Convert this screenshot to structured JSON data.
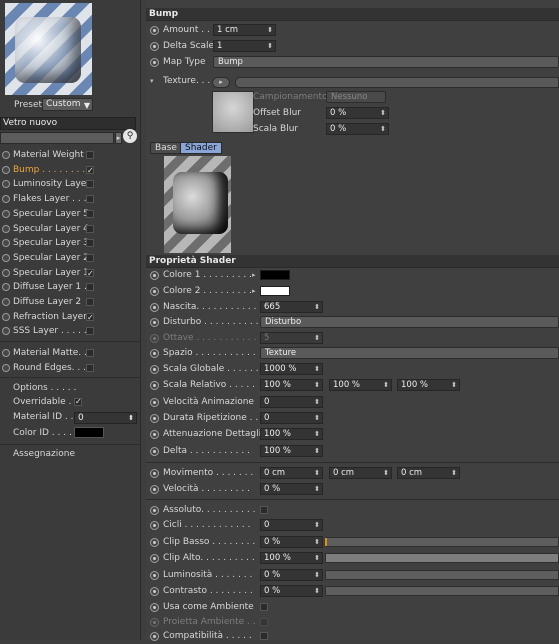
{
  "left": {
    "preset_label": "Preset",
    "preset_value": "Custom",
    "material_name": "Vetro nuovo",
    "layers": [
      {
        "label": "Material Weight",
        "checked": false,
        "active": false
      },
      {
        "label": "Bump . . . . . . . .",
        "checked": true,
        "active": true
      },
      {
        "label": "Luminosity Layer",
        "checked": false,
        "active": false
      },
      {
        "label": "Flakes Layer . . .",
        "checked": false,
        "active": false
      },
      {
        "label": "Specular Layer 5",
        "checked": false,
        "active": false
      },
      {
        "label": "Specular Layer 4",
        "checked": false,
        "active": false
      },
      {
        "label": "Specular Layer 3",
        "checked": false,
        "active": false
      },
      {
        "label": "Specular Layer 2",
        "checked": false,
        "active": false
      },
      {
        "label": "Specular Layer 1",
        "checked": true,
        "active": false
      },
      {
        "label": "Diffuse Layer 1 .",
        "checked": false,
        "active": false
      },
      {
        "label": "Diffuse Layer 2",
        "checked": false,
        "active": false
      },
      {
        "label": "Refraction Layer",
        "checked": true,
        "active": false
      },
      {
        "label": "SSS Layer . . . . .",
        "checked": false,
        "active": false
      }
    ],
    "layers2": [
      {
        "label": "Material Matte. .",
        "checked": false
      },
      {
        "label": "Round Edges. . . .",
        "checked": false
      }
    ],
    "options_label": "Options . . . . .",
    "overridable_label": "Overridable . .",
    "overridable_checked": true,
    "material_id_label": "Material ID . . .",
    "material_id_value": "0",
    "color_id_label": "Color ID . . . . .",
    "color_id_color": "#000000",
    "assegnazione_label": "Assegnazione"
  },
  "bump": {
    "header": "Bump",
    "amount_label": "Amount . . .",
    "amount_value": "1 cm",
    "delta_label": "Delta Scale",
    "delta_value": "1",
    "maptype_label": "Map Type",
    "maptype_value": "Bump",
    "texture_label": "Texture. . . . . .",
    "campionamento_label": "Campionamento",
    "campionamento_value": "Nessuno",
    "offset_blur_label": "Offset Blur",
    "offset_blur_value": "0 %",
    "scala_blur_label": "Scala Blur",
    "scala_blur_value": "0 %"
  },
  "tabs": [
    {
      "label": "Base",
      "active": false
    },
    {
      "label": "Shader",
      "active": true
    }
  ],
  "shader": {
    "header": "Proprietà Shader",
    "colore1_label": "Colore 1 . . . . . . . . .",
    "colore1_color": "#000000",
    "colore2_label": "Colore 2 . . . . . . . . .",
    "colore2_color": "#ffffff",
    "nascita_label": "Nascita. . . . . . . . . . .",
    "nascita_value": "665",
    "disturbo_label": "Disturbo . . . . . . . . . .",
    "disturbo_value": "Disturbo",
    "ottave_label": "Ottave . . . . . . . . . . .",
    "ottave_value": "5",
    "spazio_label": "Spazio . . . . . . . . . . .",
    "spazio_value": "Texture",
    "scala_globale_label": "Scala Globale . . . . . .",
    "scala_globale_value": "1000 %",
    "scala_relativo_label": "Scala Relativo . . . . .",
    "scala_relativo_values": [
      "100 %",
      "100 %",
      "100 %"
    ],
    "vel_anim_label": "Velocità Animazione",
    "vel_anim_value": "0",
    "durata_label": "Durata Ripetizione . .",
    "durata_value": "0",
    "atten_label": "Attenuazione Dettagli",
    "atten_value": "100 %",
    "delta_label": "Delta . . . . . . . . . . .",
    "delta_value": "100 %",
    "movimento_label": "Movimento . . . . . . .",
    "movimento_values": [
      "0 cm",
      "0 cm",
      "0 cm"
    ],
    "velocita_label": "Velocità . . . . . . . . .",
    "velocita_value": "0 %",
    "assoluto_label": "Assoluto. . . . . . . . . .",
    "cicli_label": "Cicli . . . . . . . . . . . .",
    "cicli_value": "0",
    "clip_basso_label": "Clip Basso . . . . . . . .",
    "clip_basso_value": "0 %",
    "clip_basso_fraction": 0.0,
    "clip_alto_label": "Clip Alto. . . . . . . . . .",
    "clip_alto_value": "100 %",
    "clip_alto_fraction": 1.0,
    "luminosita_label": "Luminosità . . . . . . .",
    "luminosita_value": "0 %",
    "luminosita_fraction": 0.0,
    "contrasto_label": "Contrasto . . . . . . . .",
    "contrasto_value": "0 %",
    "contrasto_fraction": 0.0,
    "usa_ambiente_label": "Usa come Ambiente",
    "proietta_label": "Proietta Ambiente . .",
    "compat_label": "Compatibilità . . . . ."
  }
}
